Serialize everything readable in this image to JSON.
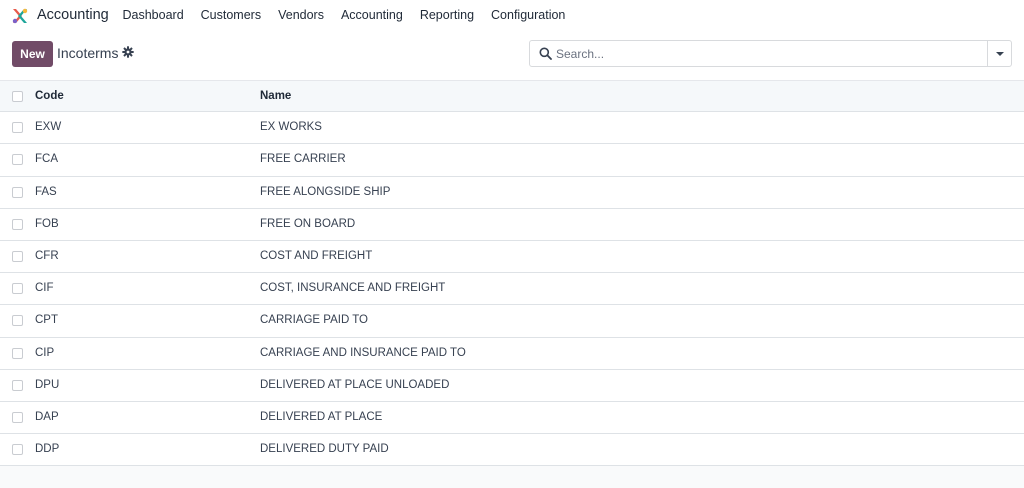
{
  "app": {
    "name": "Accounting"
  },
  "menu": [
    "Dashboard",
    "Customers",
    "Vendors",
    "Accounting",
    "Reporting",
    "Configuration"
  ],
  "control": {
    "new_label": "New",
    "breadcrumb": "Incoterms",
    "search_placeholder": "Search..."
  },
  "colors": {
    "brand": "#714b67"
  },
  "table": {
    "columns": {
      "code": "Code",
      "name": "Name"
    },
    "rows": [
      {
        "code": "EXW",
        "name": "EX WORKS"
      },
      {
        "code": "FCA",
        "name": "FREE CARRIER"
      },
      {
        "code": "FAS",
        "name": "FREE ALONGSIDE SHIP"
      },
      {
        "code": "FOB",
        "name": "FREE ON BOARD"
      },
      {
        "code": "CFR",
        "name": "COST AND FREIGHT"
      },
      {
        "code": "CIF",
        "name": "COST, INSURANCE AND FREIGHT"
      },
      {
        "code": "CPT",
        "name": "CARRIAGE PAID TO"
      },
      {
        "code": "CIP",
        "name": "CARRIAGE AND INSURANCE PAID TO"
      },
      {
        "code": "DPU",
        "name": "DELIVERED AT PLACE UNLOADED"
      },
      {
        "code": "DAP",
        "name": "DELIVERED AT PLACE"
      },
      {
        "code": "DDP",
        "name": "DELIVERED DUTY PAID"
      }
    ]
  }
}
